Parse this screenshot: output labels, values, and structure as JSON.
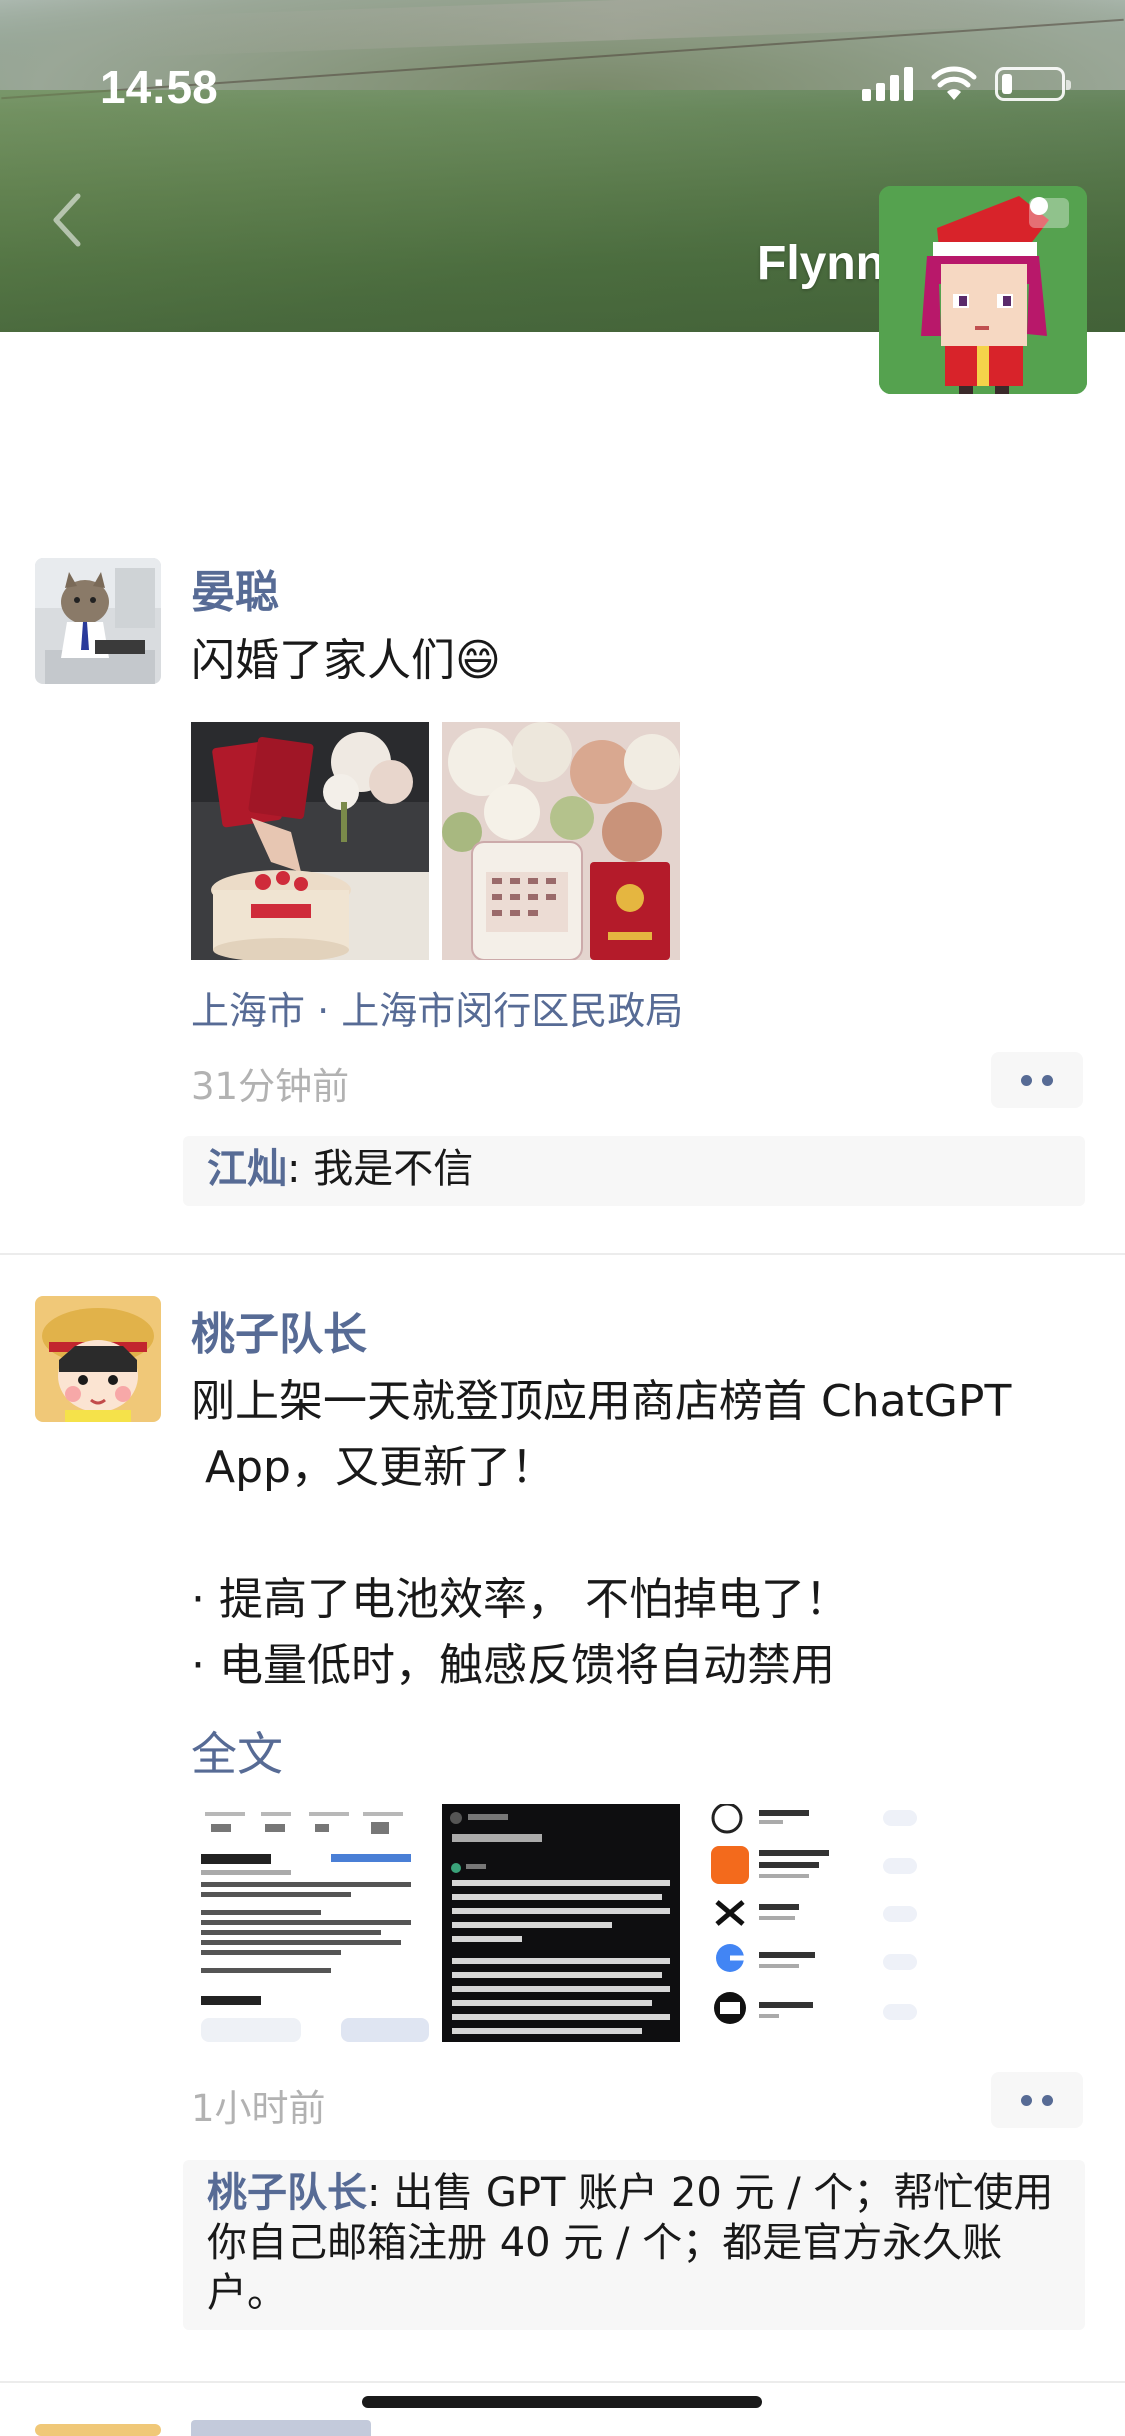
{
  "status_bar": {
    "time": "14:58"
  },
  "profile": {
    "name": "Flynn"
  },
  "posts": [
    {
      "author": "晏聪",
      "text": "闪婚了家人们😄",
      "location": "上海市 · 上海市闵行区民政局",
      "time": "31分钟前",
      "comments": [
        {
          "name": "江灿",
          "text": ": 我是不信"
        }
      ]
    },
    {
      "author": "桃子队长",
      "text": "刚上架一天就登顶应用商店榜首 ChatGPT\n App，又更新了！\n\n· 提高了电池效率， 不怕掉电了！\n· 电量低时，触感反馈将自动禁用",
      "full_text_link": "全文",
      "time": "1小时前",
      "comments": [
        {
          "name": "桃子队长",
          "text": ": 出售 GPT 账户 20 元 / 个；帮忙使用你自己邮箱注册 40 元 / 个；都是官方永久账户。"
        }
      ]
    }
  ],
  "icons": [
    "back-chevron-icon",
    "signal-icon",
    "wifi-icon",
    "battery-icon",
    "more-icon"
  ],
  "colors": {
    "link": "#576b95",
    "time": "#b2b2b2",
    "comment_bg": "#f7f7f7"
  }
}
